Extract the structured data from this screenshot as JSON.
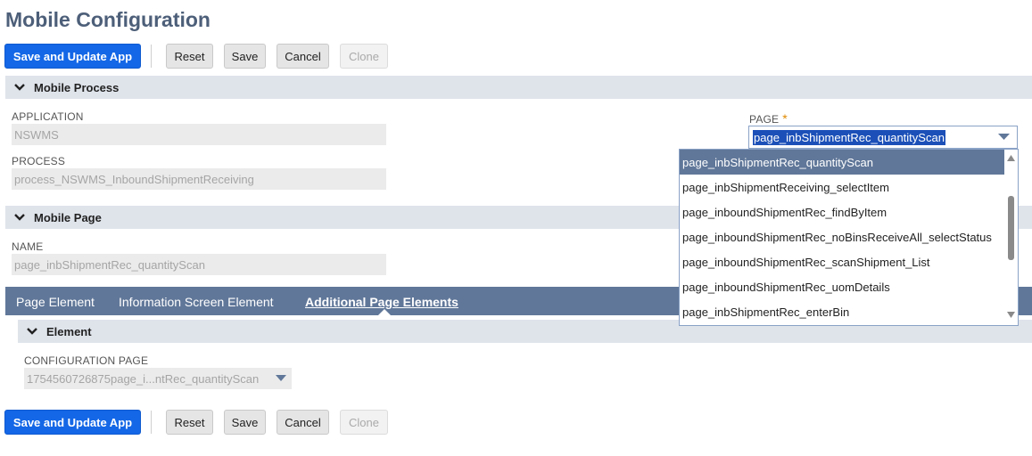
{
  "page": {
    "title": "Mobile Configuration"
  },
  "toolbar": {
    "save_update_label": "Save and Update App",
    "reset_label": "Reset",
    "save_label": "Save",
    "cancel_label": "Cancel",
    "clone_label": "Clone"
  },
  "sections": {
    "mobile_process": "Mobile Process",
    "mobile_page": "Mobile Page",
    "element": "Element"
  },
  "fields": {
    "application_label": "APPLICATION",
    "application_value": "NSWMS",
    "process_label": "PROCESS",
    "process_value": "process_NSWMS_InboundShipmentReceiving",
    "page_label": "PAGE",
    "page_required": "*",
    "page_value": "page_inbShipmentRec_quantityScan",
    "name_label": "NAME",
    "name_value": "page_inbShipmentRec_quantityScan",
    "config_page_label": "CONFIGURATION PAGE",
    "config_page_value": "1754560726875page_i...ntRec_quantityScan"
  },
  "tabs": [
    {
      "label": "Page Element",
      "active": false
    },
    {
      "label": "Information Screen Element",
      "active": false
    },
    {
      "label": "Additional Page Elements",
      "active": true
    }
  ],
  "page_dropdown": {
    "options": [
      "page_inbShipmentRec_quantityScan",
      "page_inbShipmentReceiving_selectItem",
      "page_inboundShipmentRec_findByItem",
      "page_inboundShipmentRec_noBinsReceiveAll_selectStatus",
      "page_inboundShipmentRec_scanShipment_List",
      "page_inboundShipmentRec_uomDetails",
      "page_inbShipmentRec_enterBin"
    ],
    "selected_index": 0
  },
  "colors": {
    "primary": "#1467e6",
    "title": "#4d5f79",
    "tabbar": "#607799",
    "section": "#dfe4eb",
    "selection": "#1c50b8",
    "required": "#e08a00"
  }
}
